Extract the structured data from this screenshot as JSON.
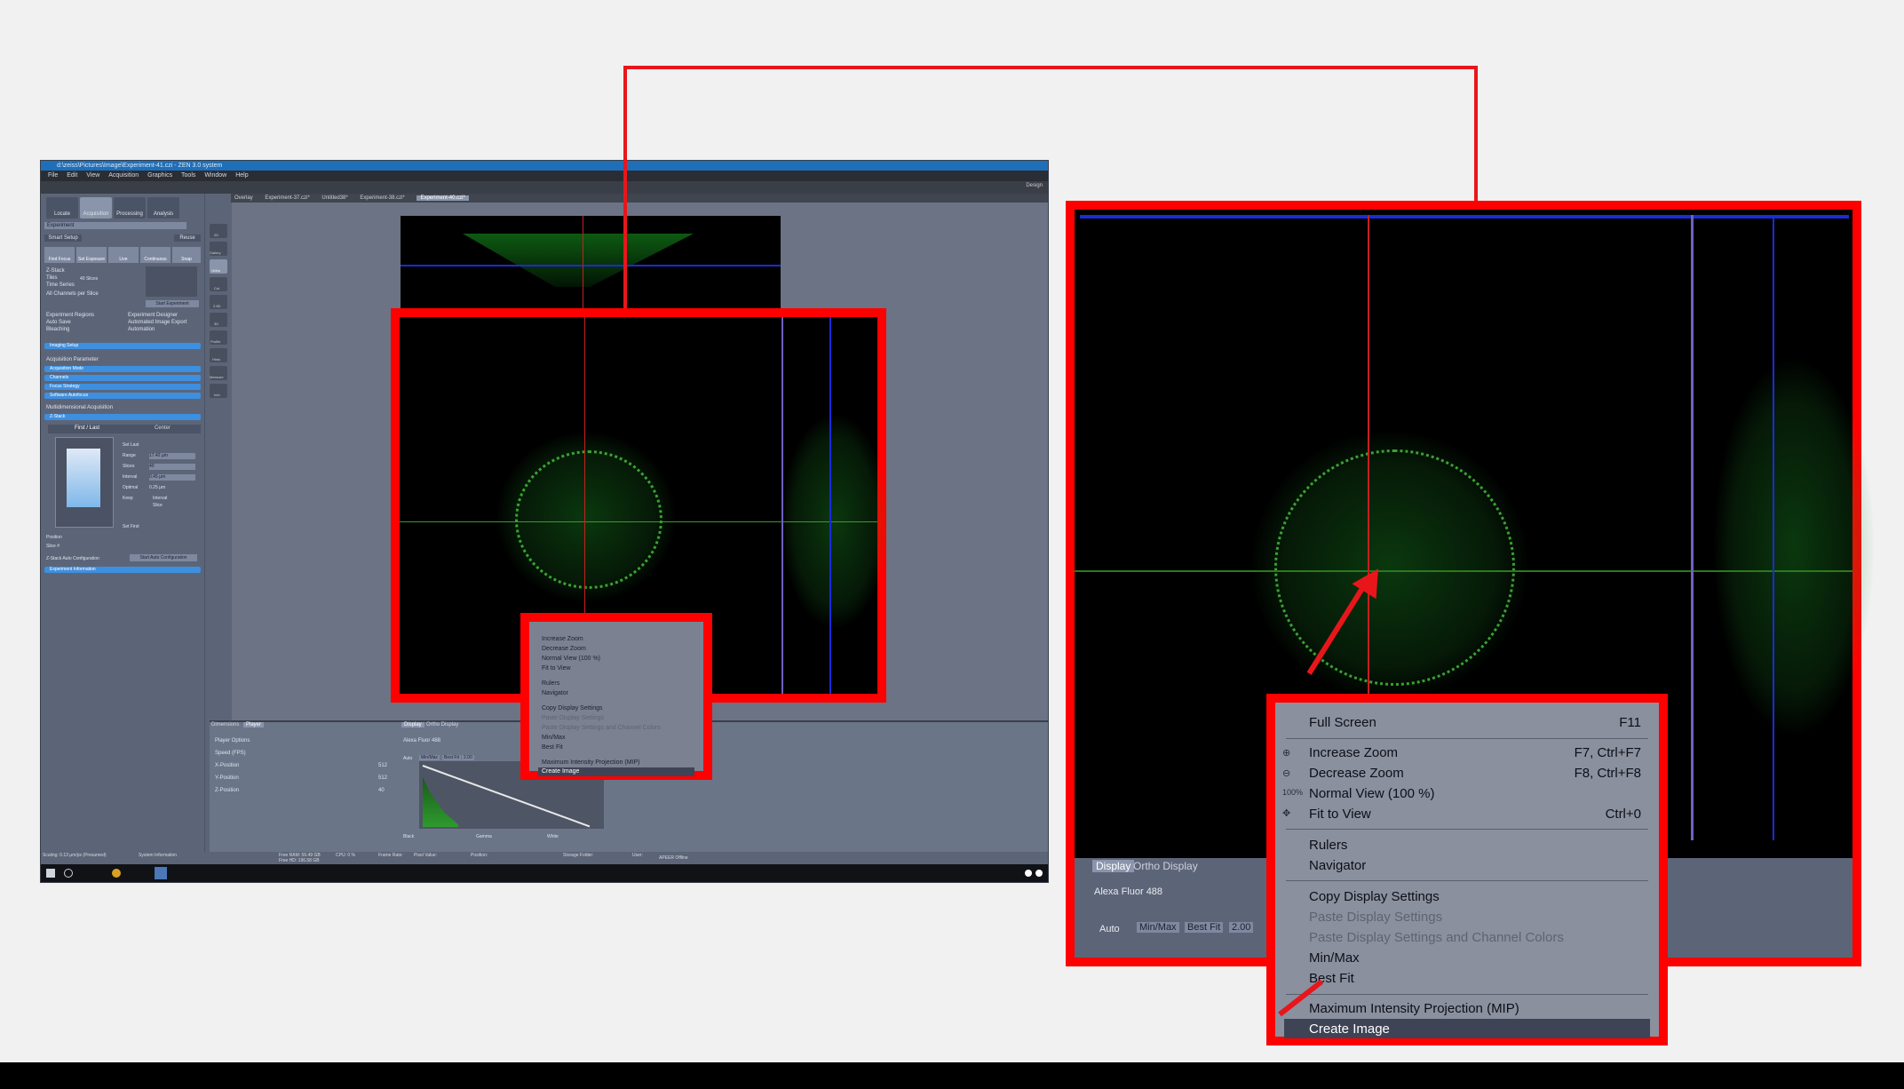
{
  "window": {
    "title": "d:\\zeiss\\Pictures\\Image\\Experiment-41.czi - ZEN 3.0 system",
    "menu": [
      "File",
      "Edit",
      "View",
      "Acquisition",
      "Graphics",
      "Tools",
      "Window",
      "Help"
    ],
    "mode_label": "Design"
  },
  "left_tabs": [
    "Locate",
    "Acquisition",
    "Processing",
    "Analysis"
  ],
  "left_pane": {
    "experiment_dropdown": "Experiment",
    "smart_setup": "Smart Setup",
    "reuse": "Reuse",
    "buttons": [
      "Find Focus",
      "Set Exposure",
      "Live",
      "Continuous",
      "Snap"
    ],
    "checks": [
      "Z-Stack",
      "Tiles",
      "Time Series"
    ],
    "zstack_slices": "40 Slices",
    "channel_mode": "All Channels per Slice",
    "start_experiment": "Start Experiment",
    "options": [
      "Experiment Regions",
      "Auto Save",
      "Bleaching",
      "Experiment Designer",
      "Automated Image Export",
      "Automation"
    ],
    "imaging_setup": "Imaging Setup",
    "acquisition_parameter": "Acquisition Parameter",
    "param_items": [
      "Acquisition Mode",
      "Channels",
      "Focus Strategy",
      "Software Autofocus"
    ],
    "multidim": "Multidimensional Acquisition",
    "zstack_section": "Z-Stack",
    "zstack_tabs": [
      "First / Last",
      "Center"
    ],
    "range_label": "Range",
    "range_value": "17.42 µm",
    "slices_label": "Slices",
    "slices_value": "40",
    "interval_label": "Interval",
    "interval_value": "0.45 µm",
    "optimal_label": "Optimal",
    "optimal_value": "0.25 µm",
    "keep_label": "Keep",
    "keep_options": [
      "Interval",
      "Slice"
    ],
    "position_label": "Position",
    "slice_label": "Slice #",
    "autoconf_label": "Z-Stack Auto Configuration",
    "autoconf_button": "Start Auto Configuration",
    "experiment_info": "Experiment Information",
    "set_last": "Set Last",
    "set_first": "Set First"
  },
  "tool_items": [
    "2D",
    "Gallery",
    "Ortho",
    "Cut",
    "2.5D",
    "3D",
    "Profile",
    "Histo",
    "Measure",
    "Info"
  ],
  "doc_tabs": [
    "Overlay",
    "Experiment-37.czi*",
    "Untitled38*",
    "Experiment-38.czi*",
    "Experiment-40.czi*"
  ],
  "bottom": {
    "tabs_left": [
      "Dimensions",
      "Player"
    ],
    "tabs_right": [
      "Display",
      "Ortho Display"
    ],
    "player_options": "Player Options",
    "speed": "Speed (FPS)",
    "positions": [
      "X-Position",
      "Y-Position",
      "Z-Position"
    ],
    "position_values": [
      "512",
      "512",
      "40"
    ],
    "channel": "Alexa Fluor 488",
    "auto": "Auto",
    "minmax": "Min/Max",
    "bestfit": "Best Fit",
    "gamma_value": "2.00",
    "black": "Black",
    "gamma": "Gamma",
    "white": "White"
  },
  "status": {
    "scaling": "Scaling: 0.13 µm/px (Presumed)",
    "system_info": "System Information",
    "free_ram": "Free RAM: 56.49 GB",
    "free_hd": "Free HD: 196.58 GB",
    "cpu": "CPU: 0 %",
    "frame_rate": "Frame Rate:",
    "pixel_value": "Pixel Value:",
    "position": "Position:",
    "storage": "Storage Folder:",
    "user": "User:",
    "offline": "APEER Offline"
  },
  "context_menu": {
    "items": [
      {
        "label": "Full Screen",
        "shortcut": "F11",
        "disabled": false
      },
      {
        "label": "Increase Zoom",
        "shortcut": "F7, Ctrl+F7",
        "disabled": false
      },
      {
        "label": "Decrease Zoom",
        "shortcut": "F8, Ctrl+F8",
        "disabled": false
      },
      {
        "label": "Normal View (100 %)",
        "shortcut": "",
        "disabled": false
      },
      {
        "label": "Fit to View",
        "shortcut": "Ctrl+0",
        "disabled": false
      },
      {
        "label": "Rulers",
        "shortcut": "",
        "disabled": false
      },
      {
        "label": "Navigator",
        "shortcut": "",
        "disabled": false
      },
      {
        "label": "Copy Display Settings",
        "shortcut": "",
        "disabled": false
      },
      {
        "label": "Paste Display Settings",
        "shortcut": "",
        "disabled": true
      },
      {
        "label": "Paste Display Settings and Channel Colors",
        "shortcut": "",
        "disabled": true
      },
      {
        "label": "Min/Max",
        "shortcut": "",
        "disabled": false
      },
      {
        "label": "Best Fit",
        "shortcut": "",
        "disabled": false
      },
      {
        "label": "Maximum Intensity Projection (MIP)",
        "shortcut": "",
        "disabled": false
      },
      {
        "label": "Create Image",
        "shortcut": "",
        "disabled": false
      }
    ],
    "highlighted": "Create Image"
  },
  "zoom_panel": {
    "tabs": [
      "Display",
      "Ortho Display"
    ],
    "channel": "Alexa Fluor 488",
    "auto": "Auto",
    "minmax": "Min/Max",
    "bestfit": "Best Fit",
    "gamma_value": "2.00"
  },
  "colors": {
    "callout": "#ff0000",
    "selection": "#3d8fe0",
    "menu_bg": "#8b909f"
  }
}
